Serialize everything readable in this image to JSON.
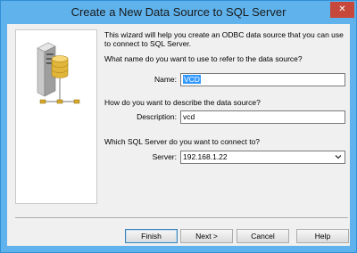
{
  "window": {
    "title": "Create a New Data Source to SQL Server",
    "close_glyph": "✕"
  },
  "intro": "This wizard will help you create an ODBC data source that you can use to connect to SQL Server.",
  "name_question": "What name do you want to use to refer to the data source?",
  "name_label": "Name:",
  "name_value": "VCD",
  "desc_question": "How do you want to describe the data source?",
  "desc_label": "Description:",
  "desc_value": "vcd",
  "server_question": "Which SQL Server do you want to connect to?",
  "server_label": "Server:",
  "server_value": "192.168.1.22",
  "buttons": {
    "finish": "Finish",
    "next": "Next >",
    "cancel": "Cancel",
    "help": "Help"
  },
  "colors": {
    "title_bar": "#5fb2ec",
    "close": "#c7473a",
    "selection": "#3399ff",
    "dialog_bg": "#f0f0f0"
  },
  "icons": [
    "server-database-icon",
    "network-icon",
    "chevron-down-icon",
    "close-icon"
  ]
}
